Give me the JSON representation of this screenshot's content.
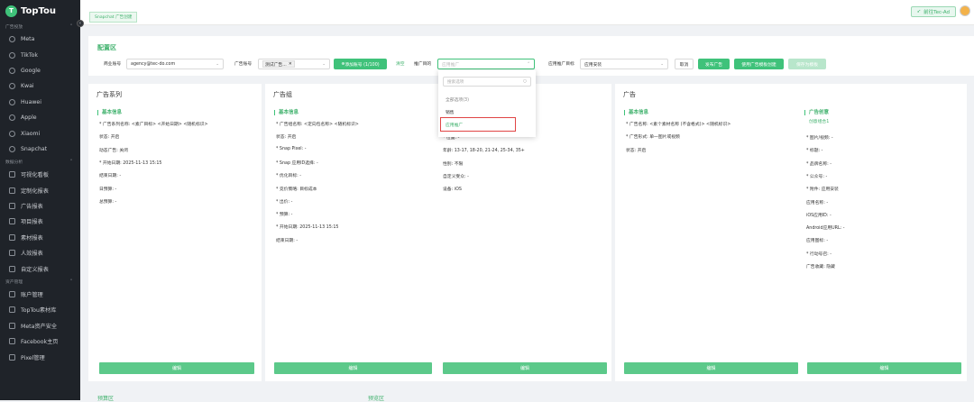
{
  "brand": {
    "name": "TopTou"
  },
  "sidebar": {
    "groups": [
      {
        "label": "广告投放",
        "items": [
          "Meta",
          "TikTok",
          "Google",
          "Kwai",
          "Huawei",
          "Apple",
          "Xiaomi",
          "Snapchat"
        ]
      },
      {
        "label": "数据分析",
        "items": [
          "可视化看板",
          "定制化报表",
          "广告报表",
          "项目报表",
          "素材报表",
          "人效报表",
          "自定义报表"
        ]
      },
      {
        "label": "资产管理",
        "items": [
          "账户管理",
          "TopTou素材库",
          "Meta资产安全",
          "Facebook主页",
          "Pixel管理"
        ]
      }
    ]
  },
  "topbar": {
    "tab_label": "Snapchat 广告创建",
    "goto_label": "前往Tec-Ad"
  },
  "config": {
    "title": "配置区",
    "bm_label": "商业账号",
    "bm_value": "agency@tec-do.com",
    "ad_account_label": "广告账号",
    "ad_account_chip": "测试广告...",
    "add_account_btn": "添加账号 (1/100)",
    "clear_link": "清空",
    "promo_label": "推广目的",
    "promo_placeholder": "应用推广",
    "app_goal_label": "应用推广目标",
    "app_goal_value": "应用安装",
    "cancel_btn": "取消",
    "publish_btn": "发布广告",
    "template_btn": "使用广告模板创建",
    "save_template_btn": "保存为模板"
  },
  "dropdown": {
    "search_placeholder": "搜索选项",
    "options": [
      "全部选项(3)",
      "销售",
      "应用推广"
    ]
  },
  "panels": {
    "campaign": {
      "title": "广告系列",
      "sub": "基本信息",
      "fields": [
        "* 广告系列名称:  <素广目标> <开始日期> <随机标识>",
        "状态:  开启",
        "动态广告:  关闭",
        "* 开始日期:  2025-11-13 15:15",
        "结束日期:  -",
        "日预算:  -",
        "总预算:  -"
      ],
      "edit": "编辑"
    },
    "adgroup": {
      "title": "广告组",
      "sub": "基本信息",
      "fields": [
        "* 广告组名称:  <定向包名称> <随机标识>",
        "状态:  开启",
        "* Snap Pixel:  -",
        "* Snap 应用ID选择:  -",
        "* 优化目标:  -",
        "* 竞价策略:  目标成本",
        "* 出价:  -",
        "* 预算:  -",
        "* 开始日期:  2025-11-13 15:15",
        "结束日期:  -"
      ],
      "edit": "编辑"
    },
    "targeting": {
      "fields": [
        "* 位置:  -",
        "年龄:  13-17, 18-20, 21-24, 25-34, 35+",
        "性别:  不限",
        "自定义受众:  -",
        "设备:  iOS"
      ],
      "edit": "编辑"
    },
    "ad": {
      "title": "广告",
      "sub": "基本信息",
      "fields": [
        "* 广告名称:  <素个素材名称 (不含格式)> <随机标识>",
        "* 广告形式:  单一图片或视频",
        "状态:  开启"
      ],
      "edit": "编辑"
    },
    "creative": {
      "sub": "广告创意",
      "group": "创意组合1",
      "fields": [
        "* 图片/视频:  -",
        "* 标题:  -",
        "* 品牌名称:  -",
        "* 公众号:  -",
        "* 附件:  应用安装",
        "应用名称:  -",
        "iOS应用ID:  -",
        "Android应用URL:  -",
        "应用图标:  -",
        "* 行动号召:  -",
        "广告收藏:  隐藏"
      ],
      "edit": "编辑"
    }
  },
  "bottom": {
    "left_title": "预算区",
    "right_title": "预览区"
  }
}
